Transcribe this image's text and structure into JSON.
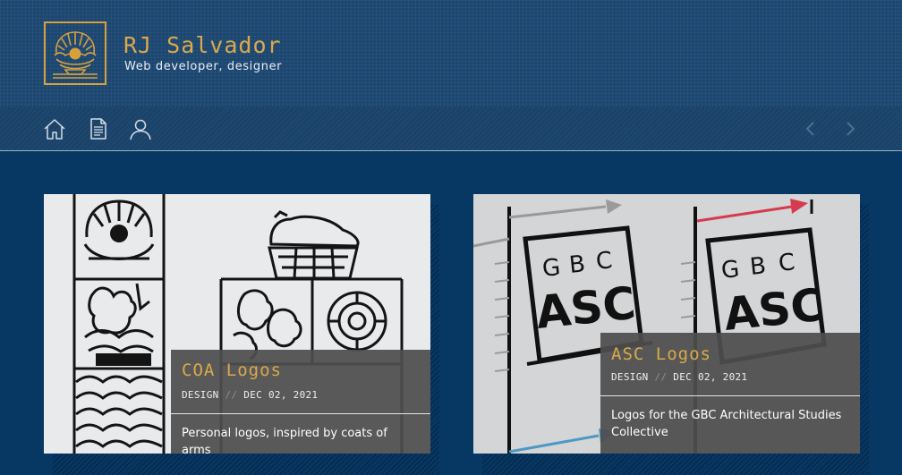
{
  "site": {
    "title": "RJ Salvador",
    "subtitle": "Web developer, designer",
    "logo_icon": "shell-pearl-logo",
    "accent_color": "#dba94a",
    "background_color": "#073763"
  },
  "nav": {
    "items": [
      {
        "name": "home",
        "icon": "home-icon"
      },
      {
        "name": "documents",
        "icon": "document-icon"
      },
      {
        "name": "about",
        "icon": "user-icon"
      }
    ],
    "prev_icon": "chevron-left-icon",
    "next_icon": "chevron-right-icon"
  },
  "posts": [
    {
      "title": "COA Logos",
      "category": "DESIGN",
      "separator": "//",
      "date": "DEC 02, 2021",
      "description": "Personal logos, inspired by coats of arms"
    },
    {
      "title": "ASC Logos",
      "category": "DESIGN",
      "separator": "//",
      "date": "DEC 02, 2021",
      "description": "Logos for the GBC Architectural Studies Collective",
      "image_text": {
        "letters": [
          "G",
          "B",
          "C"
        ],
        "word": "ASC"
      }
    }
  ]
}
